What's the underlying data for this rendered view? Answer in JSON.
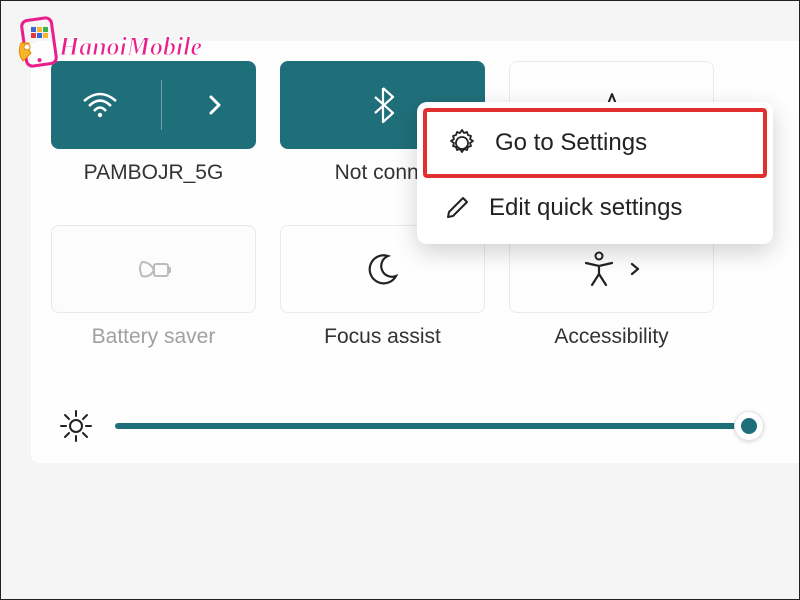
{
  "watermark": {
    "text": "HanoiMobile"
  },
  "tiles": {
    "wifi": {
      "label": "PAMBOJR_5G"
    },
    "bluetooth": {
      "label": "Not conne"
    },
    "airplane": {
      "label": ""
    },
    "battery": {
      "label": "Battery saver"
    },
    "focus": {
      "label": "Focus assist"
    },
    "accessibility": {
      "label": "Accessibility"
    }
  },
  "menu": {
    "settings": "Go to Settings",
    "edit": "Edit quick settings"
  },
  "colors": {
    "accent": "#1f6f7a",
    "highlight": "#e03030"
  }
}
